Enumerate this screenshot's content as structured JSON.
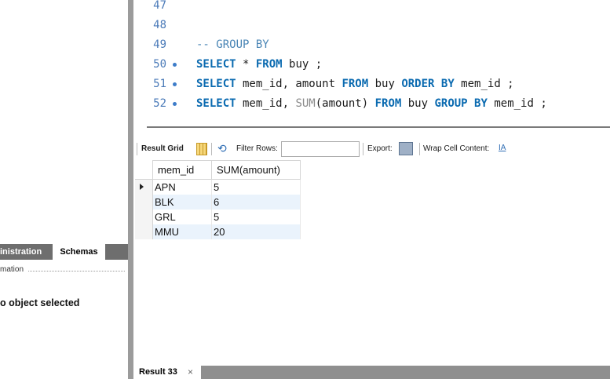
{
  "left_panel": {
    "tabs": [
      "inistration",
      "Schemas"
    ],
    "info_header": "mation",
    "no_object_text": "o object selected"
  },
  "editor": {
    "lines": [
      {
        "number": "47"
      },
      {
        "number": "48"
      },
      {
        "number": "49",
        "comment": "-- GROUP BY"
      },
      {
        "number": "50",
        "kw1": "SELECT",
        "t1": " * ",
        "kw2": "FROM",
        "t2": " buy ;"
      },
      {
        "number": "51",
        "kw1": "SELECT",
        "t1": " mem_id, amount ",
        "kw2": "FROM",
        "t2": " buy ",
        "kw3": "ORDER BY",
        "t3": " mem_id ;"
      },
      {
        "number": "52",
        "kw1": "SELECT",
        "t1": " mem_id, ",
        "fn": "SUM",
        "t1b": "(amount) ",
        "kw2": "FROM",
        "t2": " buy ",
        "kw3": "GROUP BY",
        "t3": " mem_id ;"
      }
    ]
  },
  "toolbar": {
    "result_grid": "Result Grid",
    "filter_rows": "Filter Rows:",
    "filter_value": "",
    "export": "Export:",
    "wrap_cell": "Wrap Cell Content:",
    "wrap_icon": "IA"
  },
  "result_grid": {
    "headers": [
      "mem_id",
      "SUM(amount)"
    ],
    "rows": [
      [
        "APN",
        "5"
      ],
      [
        "BLK",
        "6"
      ],
      [
        "GRL",
        "5"
      ],
      [
        "MMU",
        "20"
      ]
    ]
  },
  "bottom_tabs": {
    "result_tab": "Result 33",
    "close": "×"
  }
}
